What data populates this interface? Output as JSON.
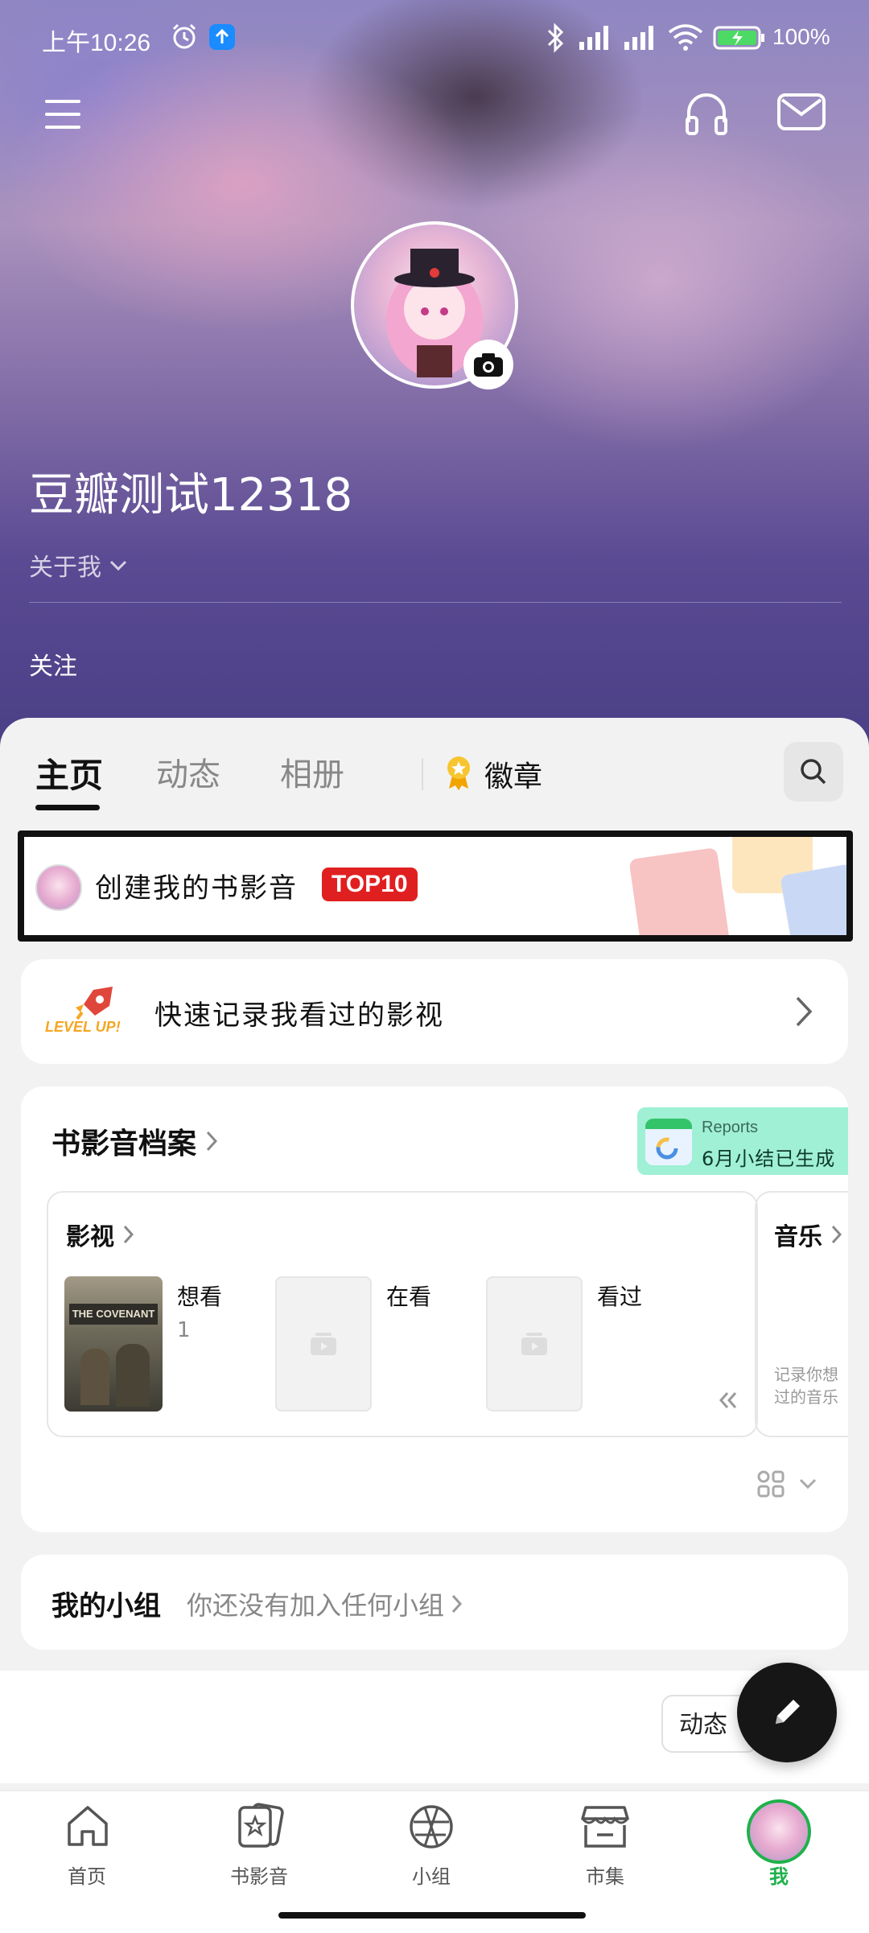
{
  "status_bar": {
    "time": "上午10:26",
    "battery": "100%"
  },
  "header": {
    "username": "豆瓣测试12318",
    "about_label": "关于我",
    "follow_label": "关注"
  },
  "tabs": {
    "home": "主页",
    "feed": "动态",
    "album": "相册",
    "badges": "徽章"
  },
  "banner": {
    "text": "创建我的书影音",
    "badge": "TOP10"
  },
  "quick_record": {
    "icon_text": "LEVEL UP!",
    "text": "快速记录我看过的影视"
  },
  "archive": {
    "title": "书影音档案",
    "report_title": "Reports",
    "report_subtitle": "6月小结已生成",
    "movies": {
      "title": "影视",
      "want": "想看",
      "want_count": "1",
      "watching": "在看",
      "watched": "看过",
      "poster_title": "THE COVENANT"
    },
    "music": {
      "title": "音乐",
      "hint_line1": "记录你想",
      "hint_line2": "过的音乐"
    }
  },
  "groups": {
    "title": "我的小组",
    "empty": "你还没有加入任何小组"
  },
  "feed_button": "动态",
  "tabbar": {
    "items": [
      "首页",
      "书影音",
      "小组",
      "市集",
      "我"
    ]
  },
  "colors": {
    "accent_green": "#1fb14b",
    "top10_red": "#e02020",
    "report_bg": "#9ff0d4"
  }
}
